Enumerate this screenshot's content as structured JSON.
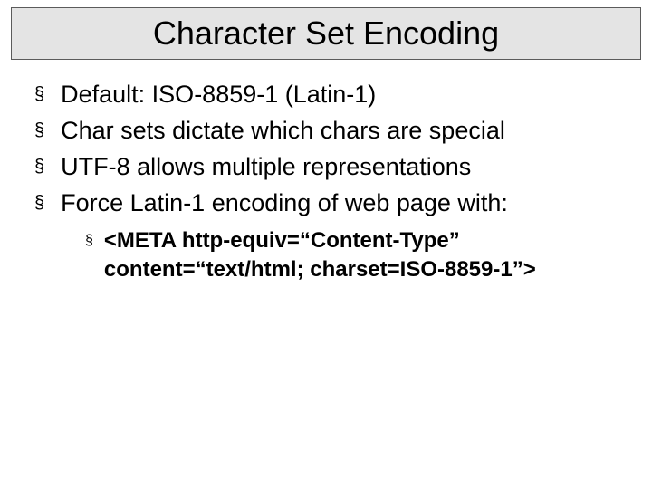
{
  "slide": {
    "title": "Character Set Encoding",
    "bullets": [
      "Default: ISO-8859-1 (Latin-1)",
      "Char sets dictate which chars are special",
      "UTF-8 allows multiple representations",
      "Force Latin-1 encoding of web page with:"
    ],
    "sub_bullets": [
      "<META http-equiv=“Content-Type” content=“text/html; charset=ISO-8859-1”>"
    ]
  }
}
